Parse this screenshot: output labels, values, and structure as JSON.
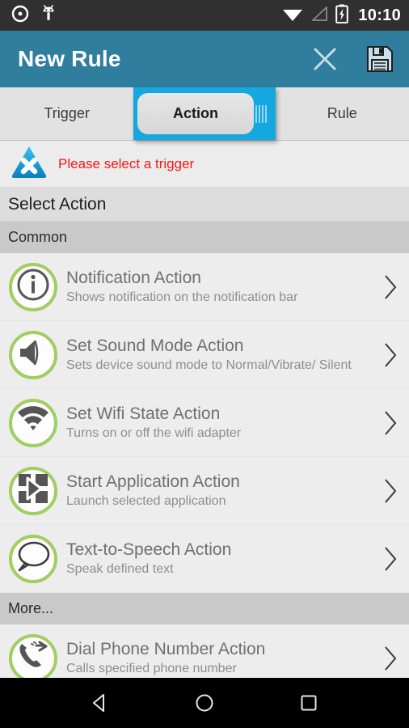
{
  "statusbar": {
    "time": "10:10",
    "icons": [
      "record-circle-icon",
      "android-robot-icon",
      "wifi-icon",
      "cell-signal-icon",
      "battery-charging-icon"
    ]
  },
  "titlebar": {
    "title": "New Rule",
    "close_label": "close-icon",
    "save_label": "save-icon",
    "bg_color": "#2F7E9D"
  },
  "tabs": {
    "selected_index": 1,
    "accent_color": "#15A7DF",
    "items": [
      {
        "label": "Trigger"
      },
      {
        "label": "Action"
      },
      {
        "label": "Rule"
      }
    ]
  },
  "warning": {
    "text": "Please select a trigger",
    "color": "#F41818",
    "icon": "warning-triangle-x-icon"
  },
  "page": {
    "heading": "Select Action"
  },
  "sections": [
    {
      "header": "Common",
      "items": [
        {
          "title": "Notification Action",
          "subtitle": "Shows notification on the notification bar",
          "icon": "info-icon"
        },
        {
          "title": "Set Sound Mode Action",
          "subtitle": "Sets device sound mode to Normal/Vibrate/ Silent",
          "icon": "speaker-icon"
        },
        {
          "title": "Set Wifi State Action",
          "subtitle": "Turns on or off the wifi adapter",
          "icon": "wifi-icon"
        },
        {
          "title": "Start Application Action",
          "subtitle": "Launch selected application",
          "icon": "app-grid-play-icon"
        },
        {
          "title": "Text-to-Speech Action",
          "subtitle": "Speak defined text",
          "icon": "speech-bubble-icon"
        }
      ]
    },
    {
      "header": "More...",
      "items": [
        {
          "title": "Dial Phone Number Action",
          "subtitle": "Calls specified phone number",
          "icon": "phone-forward-icon"
        }
      ]
    }
  ],
  "navbar": {
    "back_label": "back-button",
    "home_label": "home-button",
    "recents_label": "recents-button"
  },
  "colors": {
    "icon_ring_green": "#9FCE62",
    "list_bg": "#EDEDED",
    "section_header_bg": "#C9C9C9"
  }
}
